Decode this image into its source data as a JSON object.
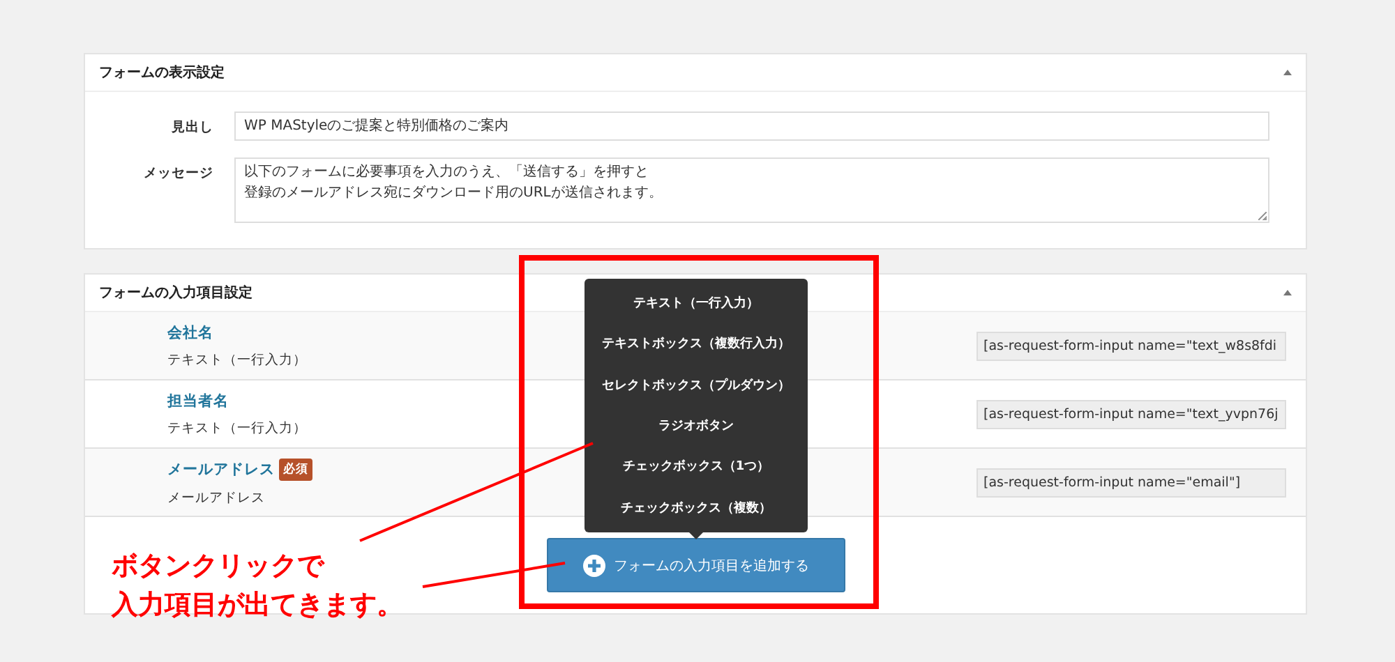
{
  "display_panel": {
    "title": "フォームの表示設定",
    "fields": [
      {
        "label": "見出し",
        "kind": "input",
        "value": "WP MAStyleのご提案と特別価格のご案内"
      },
      {
        "label": "メッセージ",
        "kind": "textarea",
        "lines": [
          "以下のフォームに必要事項を入力のうえ、「送信する」を押すと",
          "登録のメールアドレス宛にダウンロード用のURLが送信されます。"
        ]
      }
    ]
  },
  "input_panel": {
    "title": "フォームの入力項目設定",
    "items": [
      {
        "name": "会社名",
        "required": false,
        "type": "テキスト（一行入力）",
        "code": "[as-request-form-input name=\"text_w8s8fdi"
      },
      {
        "name": "担当者名",
        "required": false,
        "type": "テキスト（一行入力）",
        "code": "[as-request-form-input name=\"text_yvpn76j"
      },
      {
        "name": "メールアドレス",
        "required": true,
        "required_label": "必須",
        "type": "メールアドレス",
        "code": "[as-request-form-input name=\"email\"]"
      }
    ],
    "add_button": "フォームの入力項目を追加する"
  },
  "popup_menu": [
    "テキスト（一行入力）",
    "テキストボックス（複数行入力）",
    "セレクトボックス（プルダウン）",
    "ラジオボタン",
    "チェックボックス（1つ）",
    "チェックボックス（複数）"
  ],
  "annotation": [
    "ボタンクリックで",
    "入力項目が出てきます。"
  ]
}
